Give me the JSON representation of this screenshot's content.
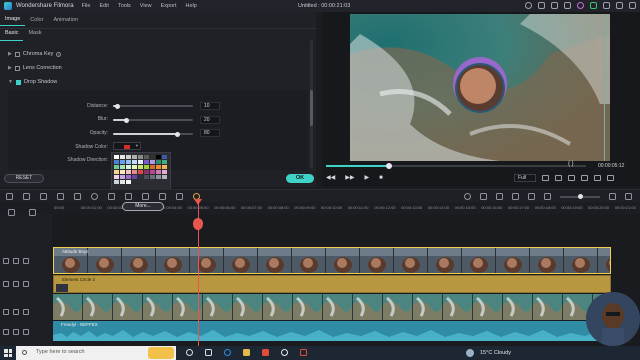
{
  "app": {
    "name": "Wondershare Filmora",
    "document_title": "Untitled : 00:00:21:03"
  },
  "menu": [
    "File",
    "Edit",
    "Tools",
    "View",
    "Export",
    "Help"
  ],
  "property_tabs": [
    "Image",
    "Color",
    "Animation"
  ],
  "sub_tabs": [
    "Basic",
    "Mask"
  ],
  "sections": {
    "chroma_key": "Chroma Key",
    "lens_correction": "Lens Correction",
    "drop_shadow": "Drop Shadow"
  },
  "drop_shadow": {
    "distance": {
      "label": "Distance:",
      "value": "10",
      "level": 0.05
    },
    "blur": {
      "label": "Blur:",
      "value": "20",
      "level": 0.15
    },
    "opacity": {
      "label": "Opacity:",
      "value": "80",
      "level": 0.8
    },
    "shadow_color": {
      "label": "Shadow Color:",
      "color": "#d42b2b"
    },
    "shadow_direction": {
      "label": "Shadow Direction:"
    }
  },
  "buttons": {
    "reset": "RESET",
    "ok": "OK",
    "more": "More..."
  },
  "preview": {
    "brackets": "{   }",
    "timecode": "00:00:05:12",
    "quality": "Full",
    "progress": 0.24
  },
  "ruler_ticks": [
    "00:00",
    "00:00:01:00",
    "00:00:02:00",
    "00:00:03:00",
    "00:00:04:00",
    "00:00:05:00",
    "00:00:06:00",
    "00:00:07:00",
    "00:00:08:00",
    "00:00:09:00",
    "00:00:10:00",
    "00:00:11:00",
    "00:00:12:00",
    "00:00:13:00",
    "00:00:14:00",
    "00:00:15:00",
    "00:00:16:00",
    "00:00:17:00",
    "00:00:18:00",
    "00:00:19:00",
    "00:00:20:00",
    "00:00:21:00"
  ],
  "tracks": {
    "track4": {
      "clip_title": "Attitude Boys"
    },
    "track3": {
      "clip_title": "Element Circle 2"
    },
    "audio": {
      "clip_title": "Freedyl - NEFFEX"
    }
  },
  "taskbar": {
    "search_placeholder": "Type here to search",
    "weather": "15°C  Cloudy"
  },
  "colors": {
    "accent": "#3fd2c7",
    "playhead": "#e8574d",
    "clip_gold": "#b8973e",
    "audio_teal": "#2f8ca4"
  }
}
